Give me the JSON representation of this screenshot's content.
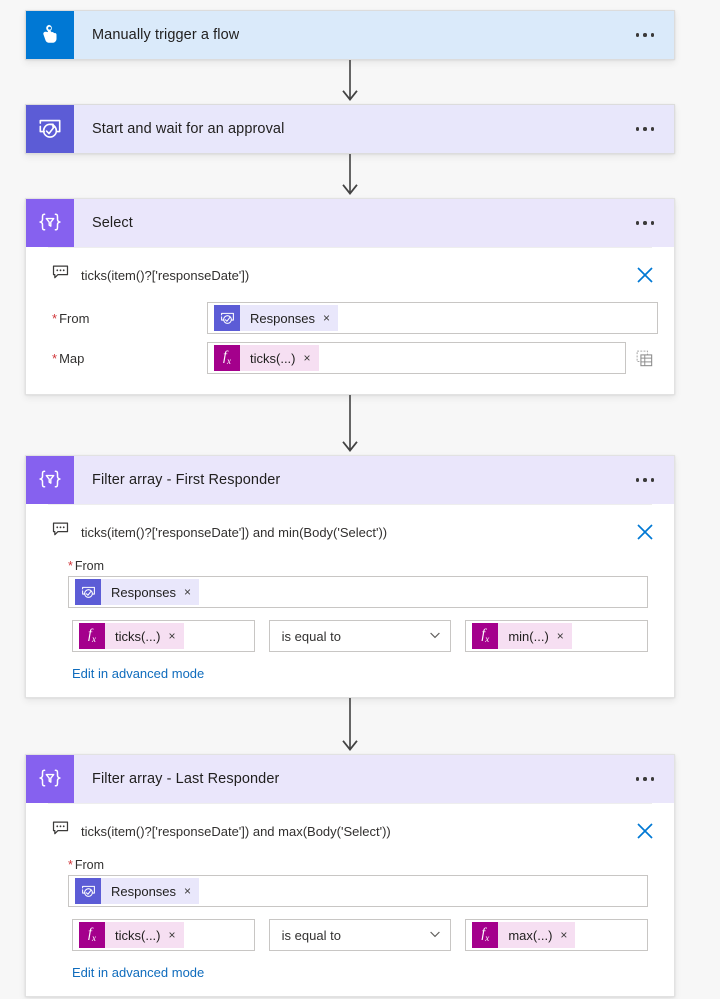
{
  "theme": {
    "page_background": "#f7f7f7",
    "trigger_tile": "#0078d4",
    "trigger_header": "#daeafa",
    "approval_tile": "#5c5cd6",
    "approval_header": "#e8e7fb",
    "data_tile": "#8661ef",
    "data_header": "#eae6fb",
    "link_blue": "#0f6cbd",
    "close_blue": "#0078d4",
    "required_red": "#d13438",
    "token_fx": "#a4008c",
    "token_fx_pill": "#f6dff2",
    "token_dynamic_pill": "#e9e7fb"
  },
  "cards": [
    {
      "id": "manually-trigger-a-flow",
      "title": "Manually trigger a flow",
      "icon": "touch-tap-icon",
      "style": "trigger",
      "expanded": false,
      "overflow_menu": "more-commands"
    },
    {
      "id": "start-and-wait-for-an-approval",
      "title": "Start and wait for an approval",
      "icon": "approval-check-icon",
      "style": "approval",
      "expanded": false,
      "overflow_menu": "more-commands"
    },
    {
      "id": "select",
      "title": "Select",
      "icon": "data-operation-filter-icon",
      "style": "data",
      "expanded": true,
      "overflow_menu": "more-commands",
      "comment": {
        "icon": "comment-icon",
        "text": "ticks(item()?['responseDate'])",
        "close_icon": "close-icon"
      },
      "layout": "inline-labels",
      "fields": [
        {
          "label": "From",
          "required": true,
          "token": {
            "icon": "approval-check-icon",
            "icon_style": "blue",
            "pill_style": "lav",
            "text": "Responses",
            "remove": "×"
          },
          "trailing_icon": null
        },
        {
          "label": "Map",
          "required": true,
          "token": {
            "icon": "fx-icon",
            "icon_style": "fx",
            "pill_style": "pink",
            "text": "ticks(...)",
            "remove": "×"
          },
          "trailing_icon": "switch-to-table-mode-icon"
        }
      ]
    },
    {
      "id": "filter-array-first-responder",
      "title": "Filter array - First Responder",
      "icon": "data-operation-filter-icon",
      "style": "data",
      "expanded": true,
      "overflow_menu": "more-commands",
      "comment": {
        "icon": "comment-icon",
        "text": "ticks(item()?['responseDate']) and min(Body('Select'))",
        "close_icon": "close-icon"
      },
      "layout": "stacked-labels",
      "from_label": "From",
      "from_required": true,
      "from_token": {
        "icon": "approval-check-icon",
        "icon_style": "blue",
        "pill_style": "lav",
        "text": "Responses",
        "remove": "×"
      },
      "condition": {
        "left_token": {
          "icon": "fx-icon",
          "icon_style": "fx",
          "pill_style": "pink",
          "text": "ticks(...)",
          "remove": "×"
        },
        "operator": "is equal to",
        "operator_caret": "chevron-down-icon",
        "right_token": {
          "icon": "fx-icon",
          "icon_style": "fx",
          "pill_style": "pink",
          "text": "min(...)",
          "remove": "×"
        }
      },
      "advanced_link": "Edit in advanced mode"
    },
    {
      "id": "filter-array-last-responder",
      "title": "Filter array - Last Responder",
      "icon": "data-operation-filter-icon",
      "style": "data",
      "expanded": true,
      "overflow_menu": "more-commands",
      "comment": {
        "icon": "comment-icon",
        "text": "ticks(item()?['responseDate']) and max(Body('Select'))",
        "close_icon": "close-icon"
      },
      "layout": "stacked-labels",
      "from_label": "From",
      "from_required": true,
      "from_token": {
        "icon": "approval-check-icon",
        "icon_style": "blue",
        "pill_style": "lav",
        "text": "Responses",
        "remove": "×"
      },
      "condition": {
        "left_token": {
          "icon": "fx-icon",
          "icon_style": "fx",
          "pill_style": "pink",
          "text": "ticks(...)",
          "remove": "×"
        },
        "operator": "is equal to",
        "operator_caret": "chevron-down-icon",
        "right_token": {
          "icon": "fx-icon",
          "icon_style": "fx",
          "pill_style": "pink",
          "text": "max(...)",
          "remove": "×"
        }
      },
      "advanced_link": "Edit in advanced mode"
    }
  ],
  "connectors": [
    {
      "from": "manually-trigger-a-flow",
      "to": "start-and-wait-for-an-approval",
      "icon": "arrow-down-icon"
    },
    {
      "from": "start-and-wait-for-an-approval",
      "to": "select",
      "icon": "arrow-down-icon"
    },
    {
      "from": "select",
      "to": "filter-array-first-responder",
      "icon": "arrow-down-icon"
    },
    {
      "from": "filter-array-first-responder",
      "to": "filter-array-last-responder",
      "icon": "arrow-down-icon"
    }
  ]
}
